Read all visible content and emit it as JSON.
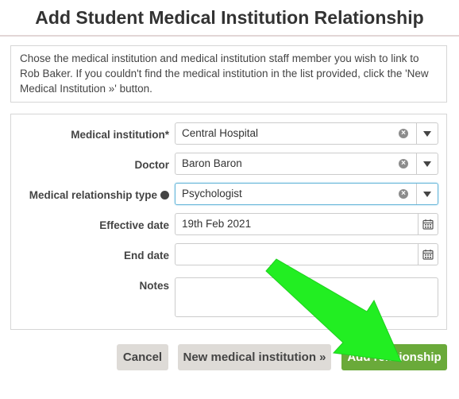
{
  "dialog": {
    "title": "Add Student Medical Institution Relationship",
    "instructions": "Chose the medical institution and medical institution staff member you wish to link to Rob Baker. If you couldn't find the medical institution in the list provided, click the 'New Medical Institution »' button."
  },
  "form": {
    "medical_institution": {
      "label": "Medical institution*",
      "value": "Central Hospital"
    },
    "doctor": {
      "label": "Doctor",
      "value": "Baron Baron"
    },
    "relationship_type": {
      "label": "Medical relationship type",
      "value": "Psychologist",
      "help_icon": "question-circle-icon"
    },
    "effective_date": {
      "label": "Effective date",
      "value": "19th Feb 2021"
    },
    "end_date": {
      "label": "End date",
      "value": ""
    },
    "notes": {
      "label": "Notes",
      "value": ""
    }
  },
  "buttons": {
    "cancel": "Cancel",
    "new_institution": "New medical institution »",
    "add": "Add relationship"
  },
  "colors": {
    "primary_button": "#6aaa3a",
    "secondary_button": "#dedbd7",
    "annotation_arrow": "#22ee22",
    "focus_border": "#66b6d9"
  }
}
